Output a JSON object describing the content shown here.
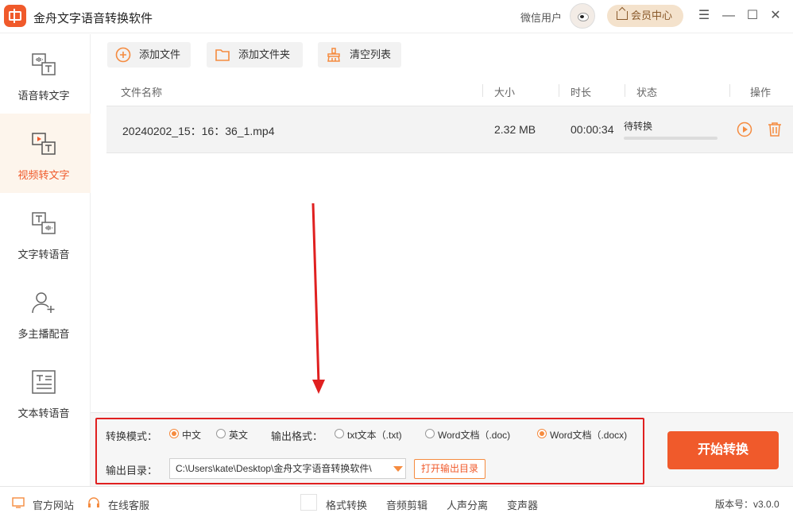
{
  "app": {
    "title": "金舟文字语音转换软件",
    "user_name": "微信用户",
    "vip_label": "会员中心",
    "accent_color": "#f05a2b"
  },
  "window_controls": [
    "menu-icon",
    "minimize-icon",
    "maximize-icon",
    "close-icon"
  ],
  "sidebar": {
    "items": [
      {
        "label": "语音转文字",
        "icon": "audio-to-text-icon",
        "active": false
      },
      {
        "label": "视频转文字",
        "icon": "video-to-text-icon",
        "active": true
      },
      {
        "label": "文字转语音",
        "icon": "text-to-audio-icon",
        "active": false
      },
      {
        "label": "多主播配音",
        "icon": "multi-speaker-icon",
        "active": false
      },
      {
        "label": "文本转语音",
        "icon": "document-to-audio-icon",
        "active": false
      }
    ]
  },
  "toolbar": {
    "add_file": "添加文件",
    "add_folder": "添加文件夹",
    "clear_list": "清空列表"
  },
  "table": {
    "headers": {
      "name": "文件名称",
      "size": "大小",
      "duration": "时长",
      "status": "状态",
      "action": "操作"
    },
    "rows": [
      {
        "name": "20240202_15：16：36_1.mp4",
        "size": "2.32 MB",
        "duration": "00:00:34",
        "status": "待转换",
        "progress": 0
      }
    ]
  },
  "settings": {
    "mode_label": "转换模式：",
    "mode_options": [
      {
        "label": "中文",
        "selected": true
      },
      {
        "label": "英文",
        "selected": false
      }
    ],
    "format_label": "输出格式：",
    "format_options": [
      {
        "label": "txt文本（.txt)",
        "selected": false
      },
      {
        "label": "Word文档（.doc)",
        "selected": false
      },
      {
        "label": "Word文档（.docx)",
        "selected": true
      }
    ],
    "output_label": "输出目录：",
    "output_path": "C:\\Users\\kate\\Desktop\\金舟文字语音转换软件\\",
    "open_dir": "打开输出目录"
  },
  "start_button": "开始转换",
  "statusbar": {
    "website": "官方网站",
    "support": "在线客服",
    "tools": [
      "格式转换",
      "音频剪辑",
      "人声分离",
      "变声器"
    ],
    "version": "版本号：v3.0.0"
  }
}
